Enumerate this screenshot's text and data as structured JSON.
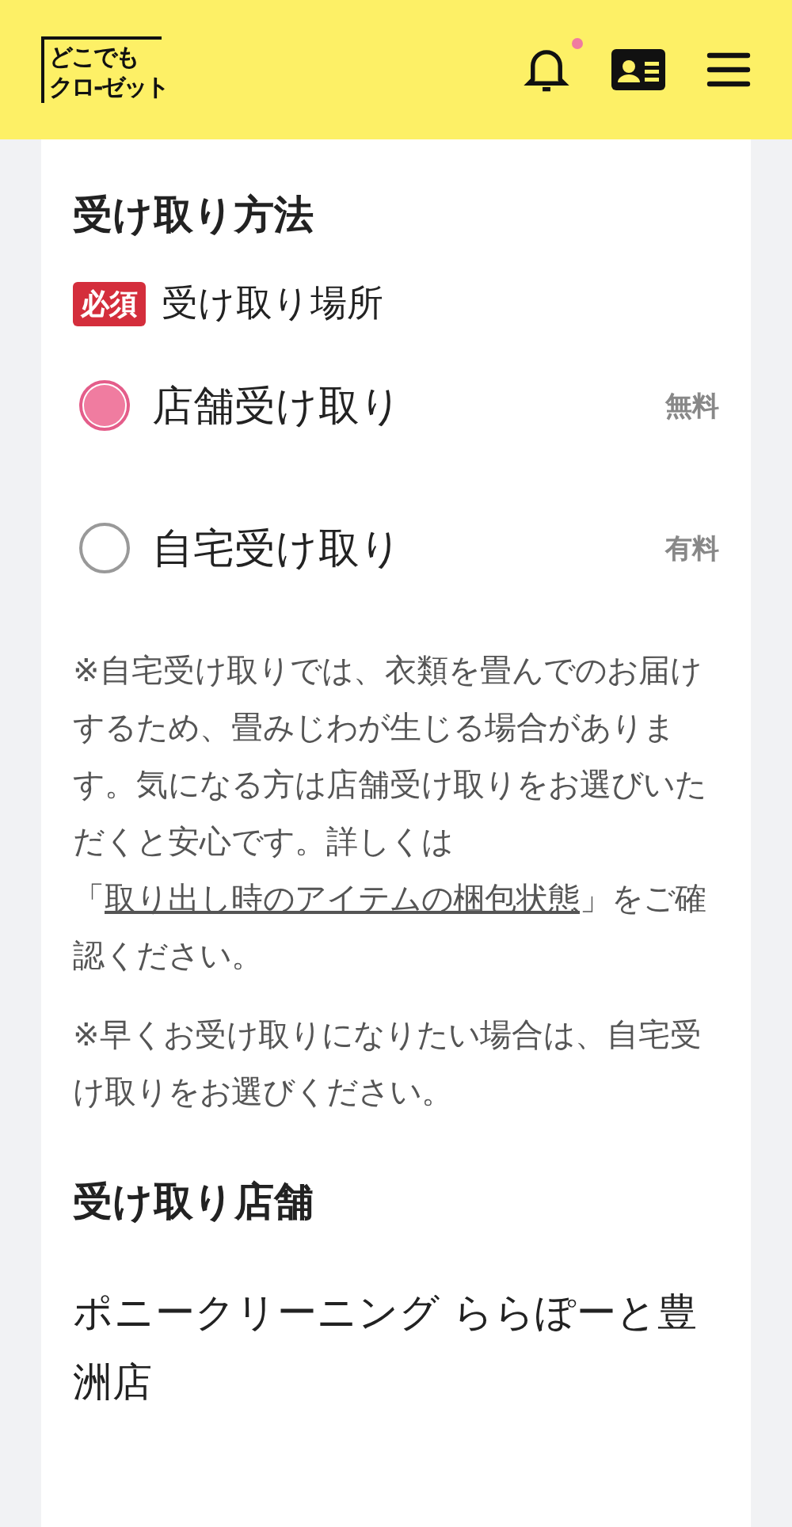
{
  "header": {
    "logo_lines": [
      "どこでも",
      "クロ-ゼット"
    ],
    "notification_unread": true
  },
  "pickup_method": {
    "title": "受け取り方法",
    "required_badge": "必須",
    "field_label": "受け取り場所",
    "options": [
      {
        "label": "店舗受け取り",
        "price": "無料",
        "selected": true
      },
      {
        "label": "自宅受け取り",
        "price": "有料",
        "selected": false
      }
    ],
    "notes": [
      {
        "before": "※自宅受け取りでは、衣類を畳んでのお届けするため、畳みじわが生じる場合があります。気になる方は店舗受け取りをお選びいただくと安心です。詳しくは「",
        "link": "取り出し時のアイテムの梱包状態",
        "after": "」をご確認ください。"
      },
      {
        "before": "※早くお受け取りになりたい場合は、自宅受け取りをお選びください。"
      }
    ]
  },
  "pickup_store": {
    "title": "受け取り店舗",
    "store_name": "ポニークリーニング ららぽーと豊洲店"
  }
}
